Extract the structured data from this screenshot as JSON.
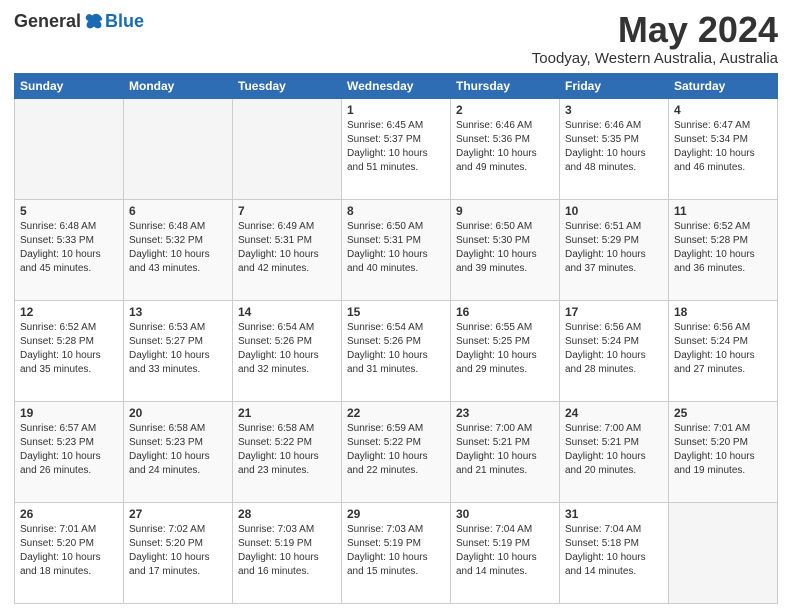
{
  "header": {
    "logo_general": "General",
    "logo_blue": "Blue",
    "month_title": "May 2024",
    "location": "Toodyay, Western Australia, Australia"
  },
  "weekdays": [
    "Sunday",
    "Monday",
    "Tuesday",
    "Wednesday",
    "Thursday",
    "Friday",
    "Saturday"
  ],
  "weeks": [
    [
      {
        "day": "",
        "info": ""
      },
      {
        "day": "",
        "info": ""
      },
      {
        "day": "",
        "info": ""
      },
      {
        "day": "1",
        "info": "Sunrise: 6:45 AM\nSunset: 5:37 PM\nDaylight: 10 hours\nand 51 minutes."
      },
      {
        "day": "2",
        "info": "Sunrise: 6:46 AM\nSunset: 5:36 PM\nDaylight: 10 hours\nand 49 minutes."
      },
      {
        "day": "3",
        "info": "Sunrise: 6:46 AM\nSunset: 5:35 PM\nDaylight: 10 hours\nand 48 minutes."
      },
      {
        "day": "4",
        "info": "Sunrise: 6:47 AM\nSunset: 5:34 PM\nDaylight: 10 hours\nand 46 minutes."
      }
    ],
    [
      {
        "day": "5",
        "info": "Sunrise: 6:48 AM\nSunset: 5:33 PM\nDaylight: 10 hours\nand 45 minutes."
      },
      {
        "day": "6",
        "info": "Sunrise: 6:48 AM\nSunset: 5:32 PM\nDaylight: 10 hours\nand 43 minutes."
      },
      {
        "day": "7",
        "info": "Sunrise: 6:49 AM\nSunset: 5:31 PM\nDaylight: 10 hours\nand 42 minutes."
      },
      {
        "day": "8",
        "info": "Sunrise: 6:50 AM\nSunset: 5:31 PM\nDaylight: 10 hours\nand 40 minutes."
      },
      {
        "day": "9",
        "info": "Sunrise: 6:50 AM\nSunset: 5:30 PM\nDaylight: 10 hours\nand 39 minutes."
      },
      {
        "day": "10",
        "info": "Sunrise: 6:51 AM\nSunset: 5:29 PM\nDaylight: 10 hours\nand 37 minutes."
      },
      {
        "day": "11",
        "info": "Sunrise: 6:52 AM\nSunset: 5:28 PM\nDaylight: 10 hours\nand 36 minutes."
      }
    ],
    [
      {
        "day": "12",
        "info": "Sunrise: 6:52 AM\nSunset: 5:28 PM\nDaylight: 10 hours\nand 35 minutes."
      },
      {
        "day": "13",
        "info": "Sunrise: 6:53 AM\nSunset: 5:27 PM\nDaylight: 10 hours\nand 33 minutes."
      },
      {
        "day": "14",
        "info": "Sunrise: 6:54 AM\nSunset: 5:26 PM\nDaylight: 10 hours\nand 32 minutes."
      },
      {
        "day": "15",
        "info": "Sunrise: 6:54 AM\nSunset: 5:26 PM\nDaylight: 10 hours\nand 31 minutes."
      },
      {
        "day": "16",
        "info": "Sunrise: 6:55 AM\nSunset: 5:25 PM\nDaylight: 10 hours\nand 29 minutes."
      },
      {
        "day": "17",
        "info": "Sunrise: 6:56 AM\nSunset: 5:24 PM\nDaylight: 10 hours\nand 28 minutes."
      },
      {
        "day": "18",
        "info": "Sunrise: 6:56 AM\nSunset: 5:24 PM\nDaylight: 10 hours\nand 27 minutes."
      }
    ],
    [
      {
        "day": "19",
        "info": "Sunrise: 6:57 AM\nSunset: 5:23 PM\nDaylight: 10 hours\nand 26 minutes."
      },
      {
        "day": "20",
        "info": "Sunrise: 6:58 AM\nSunset: 5:23 PM\nDaylight: 10 hours\nand 24 minutes."
      },
      {
        "day": "21",
        "info": "Sunrise: 6:58 AM\nSunset: 5:22 PM\nDaylight: 10 hours\nand 23 minutes."
      },
      {
        "day": "22",
        "info": "Sunrise: 6:59 AM\nSunset: 5:22 PM\nDaylight: 10 hours\nand 22 minutes."
      },
      {
        "day": "23",
        "info": "Sunrise: 7:00 AM\nSunset: 5:21 PM\nDaylight: 10 hours\nand 21 minutes."
      },
      {
        "day": "24",
        "info": "Sunrise: 7:00 AM\nSunset: 5:21 PM\nDaylight: 10 hours\nand 20 minutes."
      },
      {
        "day": "25",
        "info": "Sunrise: 7:01 AM\nSunset: 5:20 PM\nDaylight: 10 hours\nand 19 minutes."
      }
    ],
    [
      {
        "day": "26",
        "info": "Sunrise: 7:01 AM\nSunset: 5:20 PM\nDaylight: 10 hours\nand 18 minutes."
      },
      {
        "day": "27",
        "info": "Sunrise: 7:02 AM\nSunset: 5:20 PM\nDaylight: 10 hours\nand 17 minutes."
      },
      {
        "day": "28",
        "info": "Sunrise: 7:03 AM\nSunset: 5:19 PM\nDaylight: 10 hours\nand 16 minutes."
      },
      {
        "day": "29",
        "info": "Sunrise: 7:03 AM\nSunset: 5:19 PM\nDaylight: 10 hours\nand 15 minutes."
      },
      {
        "day": "30",
        "info": "Sunrise: 7:04 AM\nSunset: 5:19 PM\nDaylight: 10 hours\nand 14 minutes."
      },
      {
        "day": "31",
        "info": "Sunrise: 7:04 AM\nSunset: 5:18 PM\nDaylight: 10 hours\nand 14 minutes."
      },
      {
        "day": "",
        "info": ""
      }
    ]
  ]
}
